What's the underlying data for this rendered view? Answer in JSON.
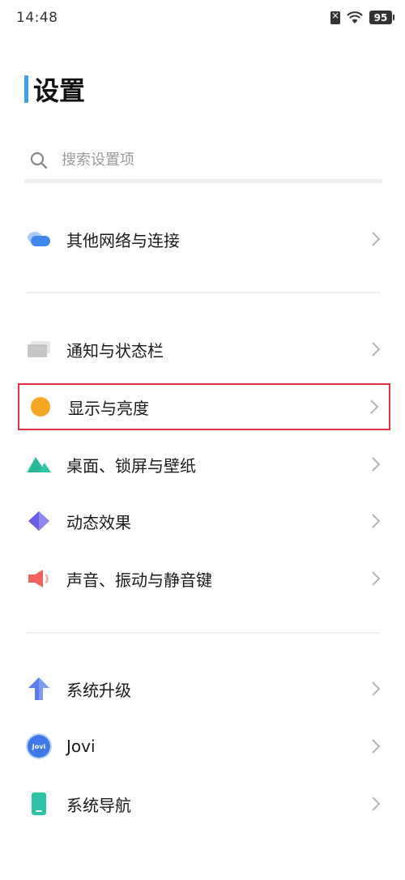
{
  "status_bar": {
    "time": "14:48",
    "battery": "95"
  },
  "header": {
    "title": "设置"
  },
  "search": {
    "placeholder": "搜索设置项"
  },
  "items": [
    {
      "label": "其他网络与连接",
      "icon": "network-icon"
    },
    {
      "label": "通知与状态栏",
      "icon": "notification-icon"
    },
    {
      "label": "显示与亮度",
      "icon": "display-brightness-icon",
      "highlighted": true
    },
    {
      "label": "桌面、锁屏与壁纸",
      "icon": "wallpaper-icon"
    },
    {
      "label": "动态效果",
      "icon": "animation-icon"
    },
    {
      "label": "声音、振动与静音键",
      "icon": "sound-icon"
    },
    {
      "label": "系统升级",
      "icon": "upgrade-arrow-icon"
    },
    {
      "label": "Jovi",
      "icon": "jovi-icon",
      "badge": "Jovi"
    },
    {
      "label": "系统导航",
      "icon": "navigation-icon"
    }
  ],
  "colors": {
    "accent": "#3ba1ef",
    "highlight_border": "#e0343e",
    "display_icon": "#f5a623",
    "wallpaper_icon": "#2ec4a6",
    "animation_icon": "#6b5ce7",
    "sound_icon": "#f0625a",
    "upgrade_icon": "#5a7cf0"
  }
}
